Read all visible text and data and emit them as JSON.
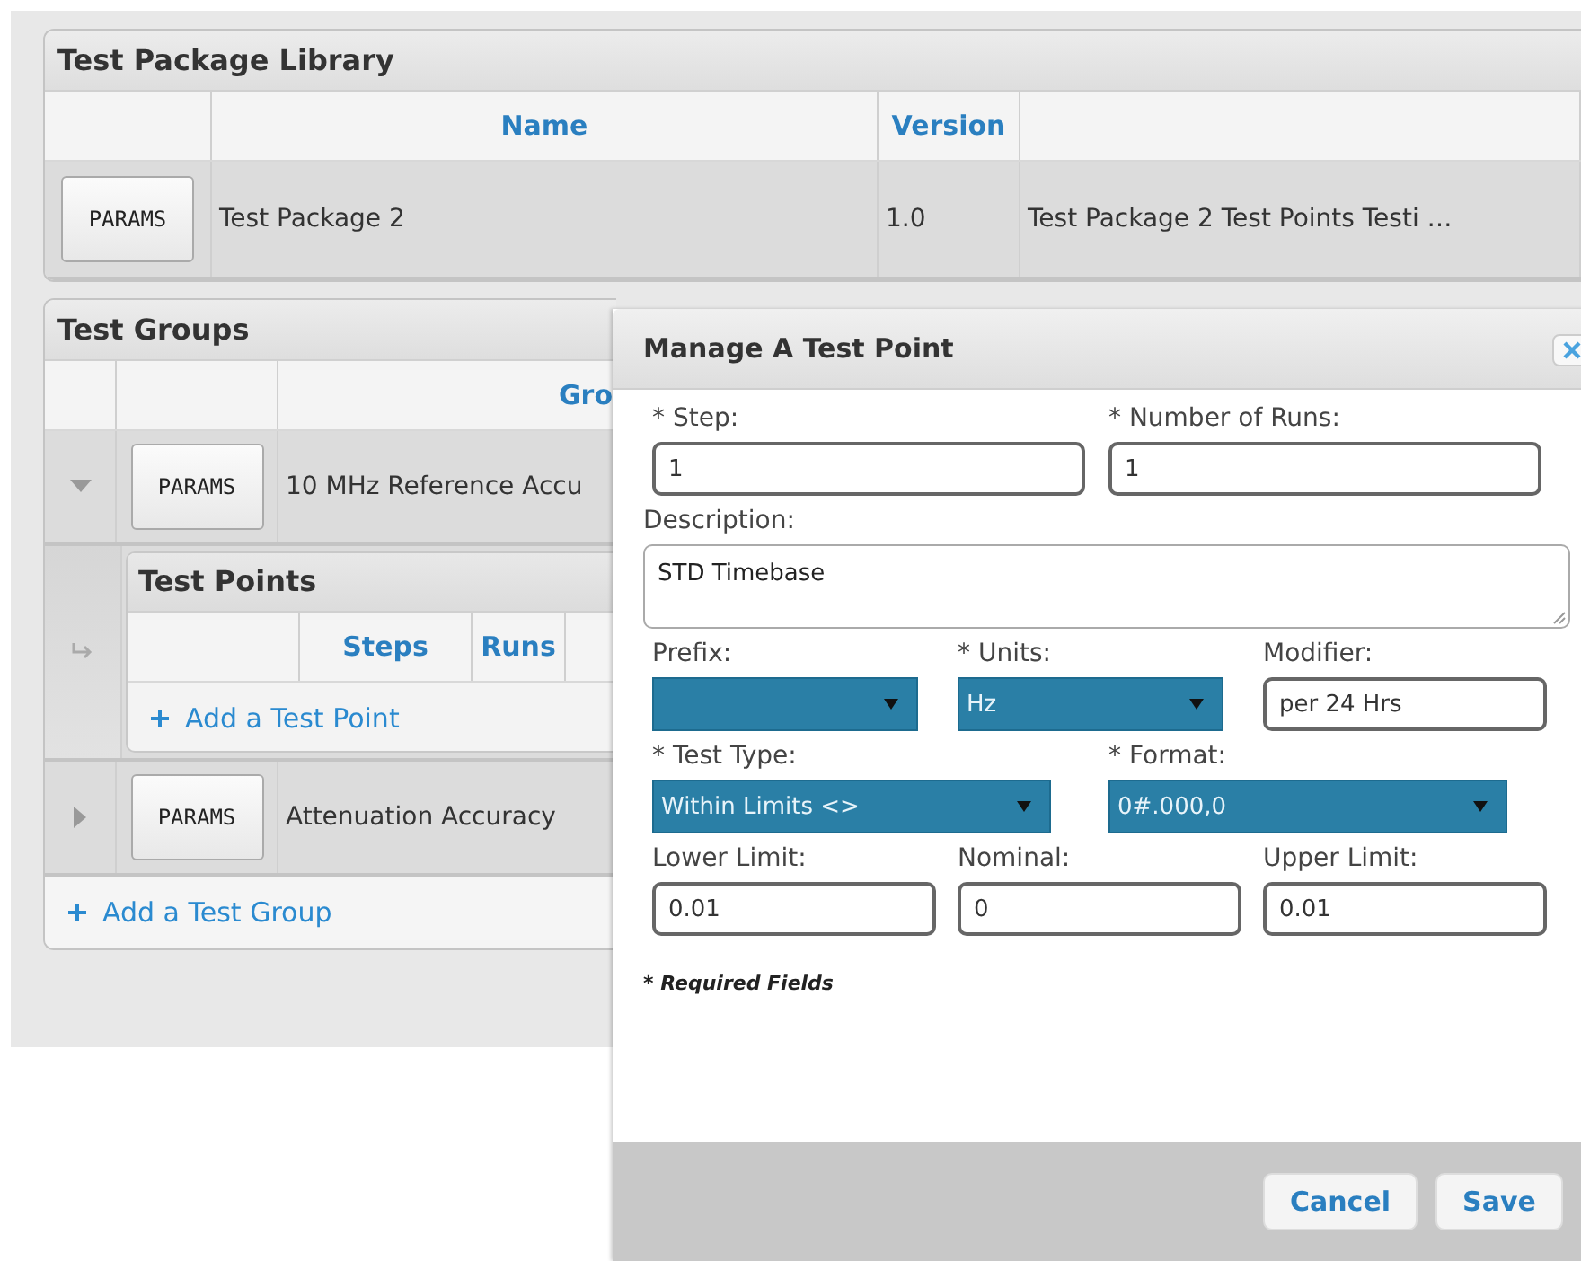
{
  "package_library": {
    "title": "Test Package Library",
    "columns": [
      "Name",
      "Version"
    ],
    "rows": [
      {
        "button": "PARAMS",
        "name": "Test Package 2",
        "version": "1.0",
        "description": "Test Package 2 Test Points Testi …"
      }
    ]
  },
  "test_groups": {
    "title": "Test Groups",
    "columns": [
      "Gro"
    ],
    "rows": [
      {
        "expanded": true,
        "button": "PARAMS",
        "name": "10 MHz Reference Accu",
        "test_points": {
          "title": "Test Points",
          "columns": [
            "Steps",
            "Runs"
          ],
          "add_link": "Add a Test Point"
        }
      },
      {
        "expanded": false,
        "button": "PARAMS",
        "name": "Attenuation Accuracy"
      }
    ],
    "add_link": "Add a Test Group"
  },
  "dialog": {
    "title": "Manage A Test Point",
    "rows": [
      [
        {
          "kind": "input",
          "label": "* Step:",
          "value": "1"
        },
        {
          "kind": "input",
          "label": "* Number of Runs:",
          "value": "1"
        }
      ],
      [
        {
          "kind": "textarea",
          "label": "Description:",
          "value": "STD Timebase"
        }
      ],
      [
        {
          "kind": "select",
          "label": "Prefix:"
        },
        {
          "kind": "select",
          "label": "* Units:",
          "value": "Hz"
        },
        {
          "kind": "input",
          "label": "Modifier:",
          "value": "per 24 Hrs"
        }
      ],
      [
        {
          "kind": "select",
          "label": "* Test Type:",
          "value": "Within Limits <>"
        },
        {
          "kind": "select",
          "label": "* Format:",
          "value": "0#.000,0"
        }
      ],
      [
        {
          "kind": "input",
          "label": "Lower Limit:",
          "value": "0.01"
        },
        {
          "kind": "input",
          "label": "Nominal:",
          "value": "0"
        },
        {
          "kind": "input",
          "label": "Upper Limit:",
          "value": "0.01"
        }
      ]
    ],
    "note": "* Required Fields",
    "buttons": [
      "Cancel",
      "Save"
    ]
  }
}
